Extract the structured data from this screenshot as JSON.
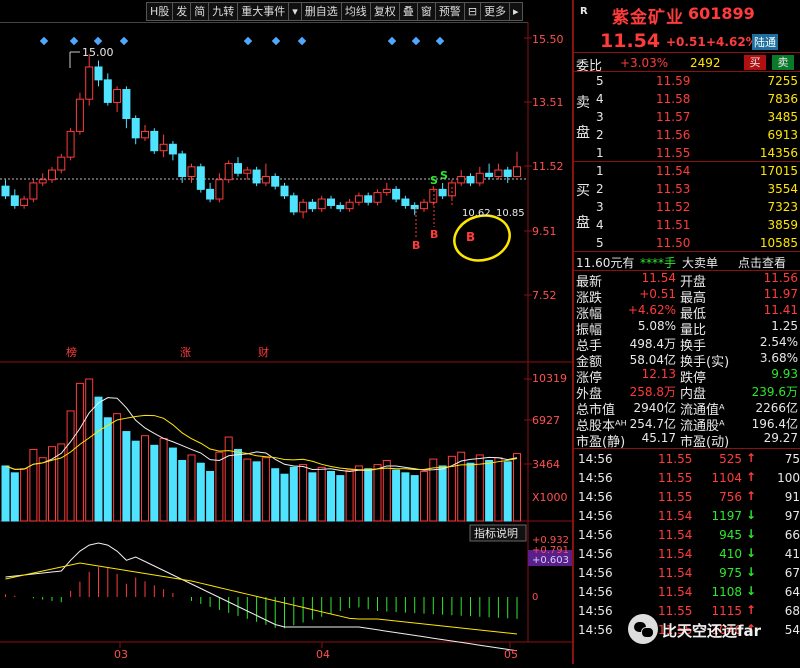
{
  "toolbar": {
    "items": [
      "H股",
      "发",
      "简",
      "九转",
      "重大事件",
      "▾",
      "删自选",
      "均线",
      "复权",
      "叠",
      "窗",
      "预警",
      "⊟",
      "更多",
      "▸"
    ]
  },
  "chart": {
    "price_ticks": [
      "15.50",
      "13.51",
      "11.52",
      "9.51",
      "7.52"
    ],
    "vol_ticks": [
      "10319",
      "6927",
      "3464",
      "X1000"
    ],
    "macd_ticks": [
      "+0.932",
      "+0.791",
      "+0.603",
      "0"
    ],
    "date_labels": [
      "03",
      "04",
      "05"
    ],
    "event_labels": [
      "榜",
      "涨",
      "财"
    ],
    "annotations": {
      "peak": "15.00",
      "lowA": "10.62",
      "lowB": "10.85"
    },
    "indicator_btn": "指标说明",
    "signal_labels": {
      "s1": "S",
      "s2": "S",
      "b1": "B",
      "b2": "B",
      "b3": "B"
    },
    "colors": {
      "up": "#ff3b3b",
      "down": "#4fe3ff",
      "bg": "#000000",
      "grid": "#8b1010"
    }
  },
  "quote": {
    "flag": "R",
    "name": "紫金矿业",
    "code": "601899",
    "price": "11.54",
    "change": "+0.51",
    "pct": "+4.62%",
    "tag": "陆通",
    "weibi_label": "委比",
    "weibi": "+3.03%",
    "weicha": "2492",
    "buy_btn": "买",
    "sell_btn": "卖",
    "sell_side_label": [
      "卖",
      "盘"
    ],
    "buy_side_label": [
      "买",
      "盘"
    ],
    "asks": [
      {
        "lvl": "5",
        "price": "11.59",
        "vol": "7255"
      },
      {
        "lvl": "4",
        "price": "11.58",
        "vol": "7836"
      },
      {
        "lvl": "3",
        "price": "11.57",
        "vol": "3485"
      },
      {
        "lvl": "2",
        "price": "11.56",
        "vol": "6913"
      },
      {
        "lvl": "1",
        "price": "11.55",
        "vol": "14356"
      }
    ],
    "bids": [
      {
        "lvl": "1",
        "price": "11.54",
        "vol": "17015"
      },
      {
        "lvl": "2",
        "price": "11.53",
        "vol": "3554"
      },
      {
        "lvl": "3",
        "price": "11.52",
        "vol": "7323"
      },
      {
        "lvl": "4",
        "price": "11.51",
        "vol": "3859"
      },
      {
        "lvl": "5",
        "price": "11.50",
        "vol": "10585"
      }
    ],
    "bigorder": {
      "a": "11.60元有",
      "b": "****手",
      "c": "大卖单",
      "d": "点击查看"
    },
    "stats": [
      {
        "l1": "最新",
        "v1": "11.54",
        "l2": "开盘",
        "v2": "11.56"
      },
      {
        "l1": "涨跌",
        "v1": "+0.51",
        "l2": "最高",
        "v2": "11.97"
      },
      {
        "l1": "涨幅",
        "v1": "+4.62%",
        "l2": "最低",
        "v2": "11.41"
      },
      {
        "l1": "振幅",
        "v1": "5.08%",
        "l2": "量比",
        "v2": "1.25"
      },
      {
        "l1": "总手",
        "v1": "498.4万",
        "l2": "换手",
        "v2": "2.54%"
      },
      {
        "l1": "金额",
        "v1": "58.04亿",
        "l2": "换手(实)",
        "v2": "3.68%"
      },
      {
        "l1": "涨停",
        "v1": "12.13",
        "l2": "跌停",
        "v2": "9.93"
      },
      {
        "l1": "外盘",
        "v1": "258.8万",
        "l2": "内盘",
        "v2": "239.6万"
      },
      {
        "l1": "总市值",
        "v1": "2940亿",
        "l2": "流通值ᴬ",
        "v2": "2266亿"
      },
      {
        "l1": "总股本ᴬᴴ",
        "v1": "254.7亿",
        "l2": "流通股ᴬ",
        "v2": "196.4亿"
      },
      {
        "l1": "市盈(静)",
        "v1": "45.17",
        "l2": "市盈(动)",
        "v2": "29.27"
      }
    ],
    "ticks": [
      {
        "t": "14:56",
        "p": "11.55",
        "v": "525",
        "d": "↑",
        "n": "75"
      },
      {
        "t": "14:56",
        "p": "11.55",
        "v": "1104",
        "d": "↑",
        "n": "100"
      },
      {
        "t": "14:56",
        "p": "11.55",
        "v": "756",
        "d": "↑",
        "n": "91"
      },
      {
        "t": "14:56",
        "p": "11.54",
        "v": "1197",
        "d": "↓",
        "n": "97"
      },
      {
        "t": "14:56",
        "p": "11.54",
        "v": "945",
        "d": "↓",
        "n": "66"
      },
      {
        "t": "14:56",
        "p": "11.54",
        "v": "410",
        "d": "↓",
        "n": "41"
      },
      {
        "t": "14:56",
        "p": "11.54",
        "v": "975",
        "d": "↓",
        "n": "67"
      },
      {
        "t": "14:56",
        "p": "11.54",
        "v": "1108",
        "d": "↓",
        "n": "64"
      },
      {
        "t": "14:56",
        "p": "11.55",
        "v": "1115",
        "d": "↑",
        "n": "68"
      },
      {
        "t": "14:56",
        "p": "11.55",
        "v": "1046",
        "d": "↑",
        "n": "54"
      }
    ],
    "watermark": "比天空还远far"
  }
}
